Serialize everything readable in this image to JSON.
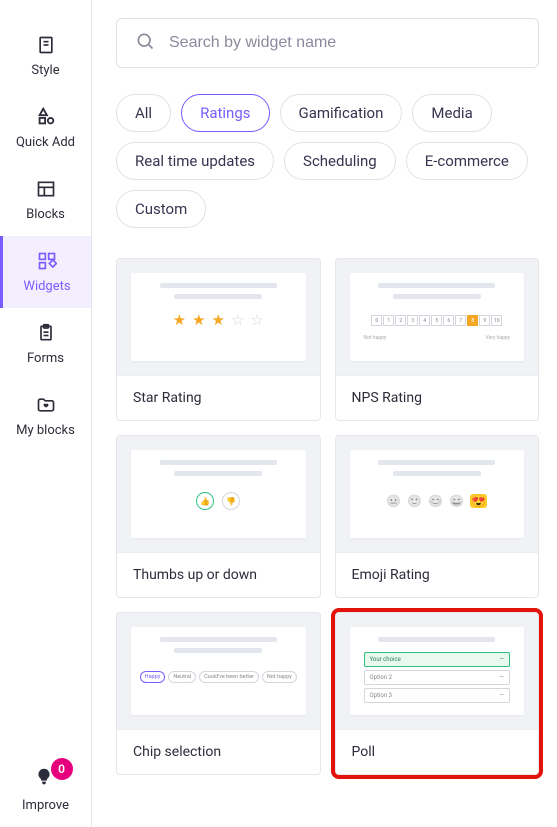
{
  "sidebar": {
    "items": [
      {
        "label": "Style"
      },
      {
        "label": "Quick Add"
      },
      {
        "label": "Blocks"
      },
      {
        "label": "Widgets"
      },
      {
        "label": "Forms"
      },
      {
        "label": "My blocks"
      }
    ]
  },
  "improve": {
    "label": "Improve",
    "badge": "0"
  },
  "search": {
    "placeholder": "Search by widget name"
  },
  "filters": [
    "All",
    "Ratings",
    "Gamification",
    "Media",
    "Real time updates",
    "Scheduling",
    "E-commerce",
    "Custom"
  ],
  "filter_active_index": 1,
  "widgets": [
    {
      "label": "Star Rating"
    },
    {
      "label": "NPS Rating"
    },
    {
      "label": "Thumbs up or down"
    },
    {
      "label": "Emoji Rating"
    },
    {
      "label": "Chip selection"
    },
    {
      "label": "Poll",
      "highlighted": true
    }
  ],
  "preview": {
    "nps_labels": {
      "left": "Not happy",
      "right": "Very happy"
    },
    "chips": [
      "Happy",
      "Neutral",
      "Could've been better",
      "Not happy"
    ],
    "poll_options": [
      "Your choice",
      "Option 2",
      "Option 3"
    ]
  }
}
